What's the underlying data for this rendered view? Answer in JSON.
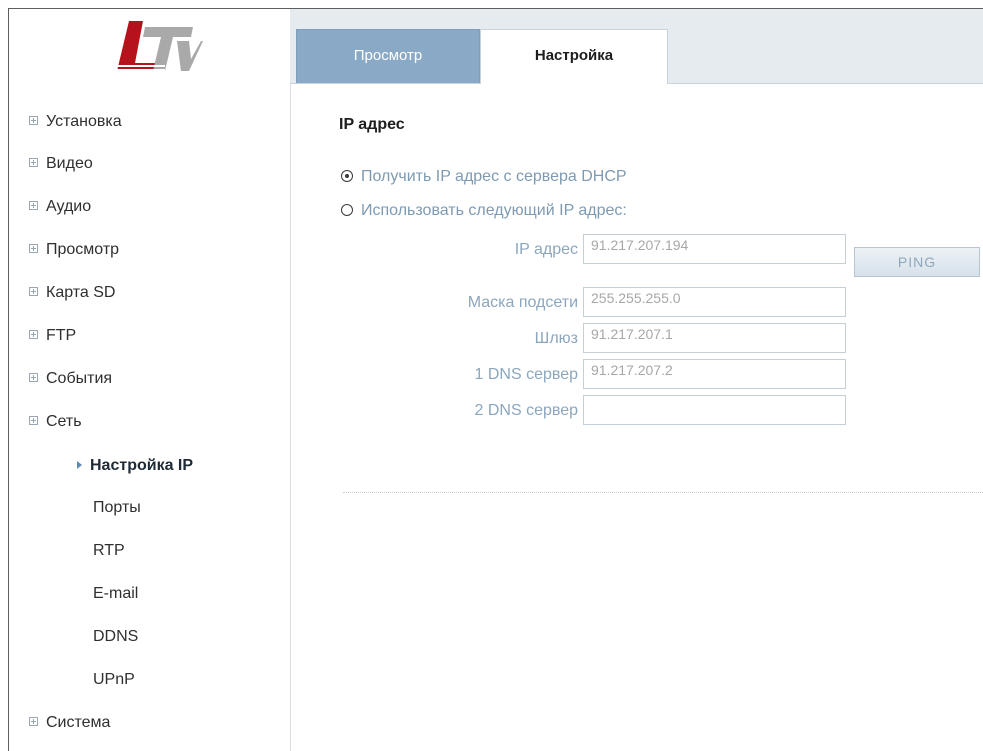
{
  "logo": {
    "text": "LTV",
    "brand_colors": [
      "#b5121b",
      "#9a9a9a"
    ]
  },
  "tabs": [
    {
      "label": "Просмотр",
      "active": false
    },
    {
      "label": "Настройка",
      "active": true
    }
  ],
  "sidebar": {
    "items": [
      {
        "label": "Установка"
      },
      {
        "label": "Видео"
      },
      {
        "label": "Аудио"
      },
      {
        "label": "Просмотр"
      },
      {
        "label": "Карта SD"
      },
      {
        "label": "FTP"
      },
      {
        "label": "События"
      },
      {
        "label": "Сеть"
      }
    ],
    "network_sub": [
      {
        "label": "Настройка IP",
        "active": true
      },
      {
        "label": "Порты"
      },
      {
        "label": "RTP"
      },
      {
        "label": "E-mail"
      },
      {
        "label": "DDNS"
      },
      {
        "label": "UPnP"
      }
    ],
    "system": {
      "label": "Система"
    }
  },
  "main": {
    "title": "IP адрес",
    "radio_dhcp": {
      "label": "Получить IP адрес с сервера DHCP",
      "checked": true
    },
    "radio_static": {
      "label": "Использовать следующий IP адрес:",
      "checked": false
    },
    "fields": [
      {
        "label": "IP адрес",
        "value": "91.217.207.194"
      },
      {
        "label": "Маска подсети",
        "value": "255.255.255.0"
      },
      {
        "label": "Шлюз",
        "value": "91.217.207.1"
      },
      {
        "label": "1 DNS сервер",
        "value": "91.217.207.2"
      },
      {
        "label": "2 DNS сервер",
        "value": ""
      }
    ],
    "ping_label": "PING"
  }
}
